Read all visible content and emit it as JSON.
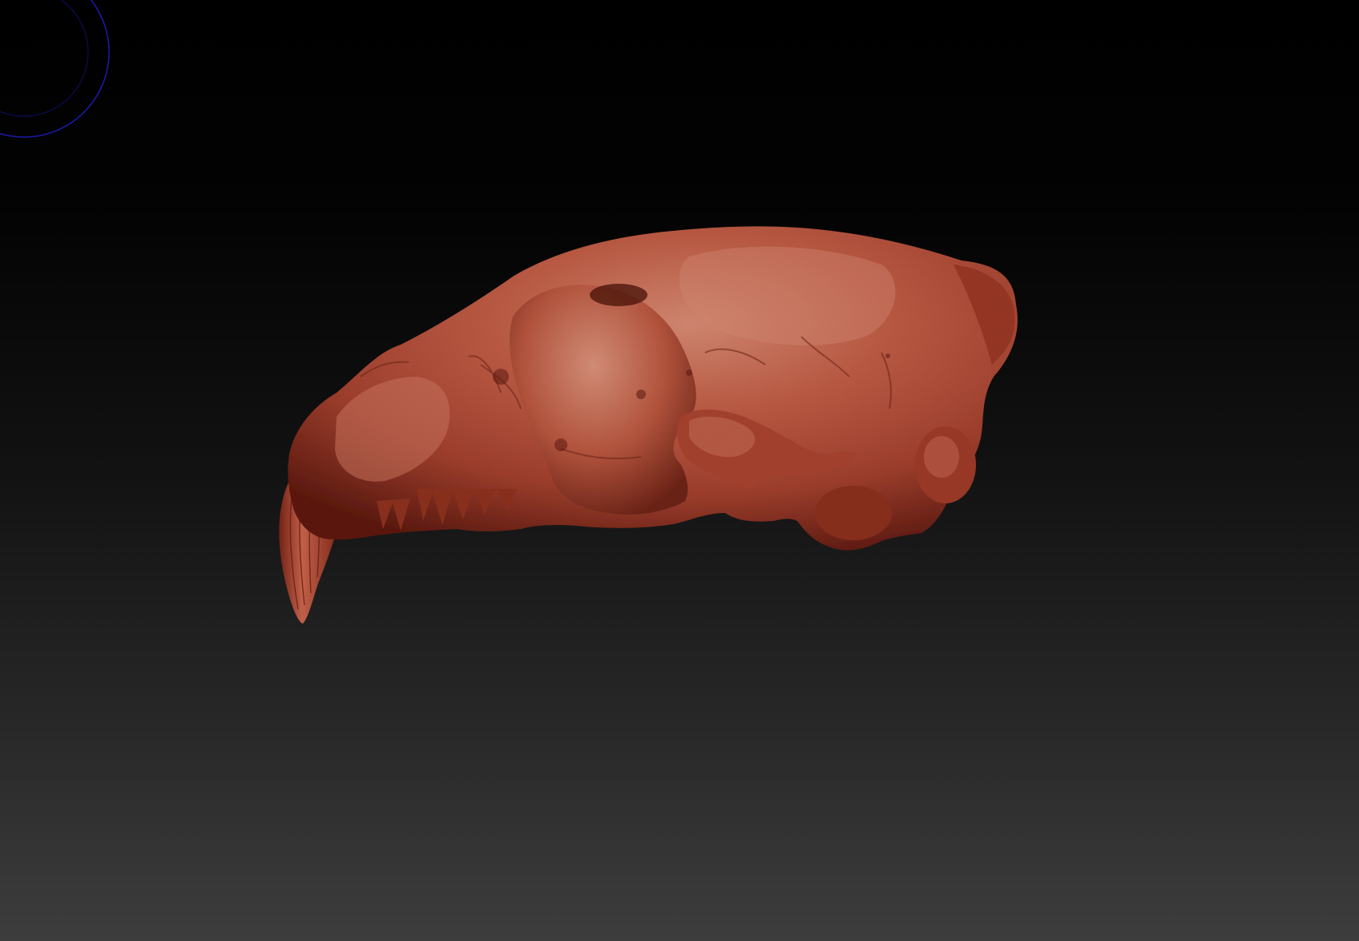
{
  "app": {
    "viewport_label": ""
  },
  "colors": {
    "background_top": "#000000",
    "background_bottom": "#3d3d3d",
    "model_base": "#b04a36",
    "model_highlight": "#d07a64",
    "model_shadow": "#5e1a10",
    "brush_cursor": "#1a1aa8"
  },
  "viewport": {
    "model_name": "",
    "cursor_icon": "brush-cursor-icon"
  }
}
